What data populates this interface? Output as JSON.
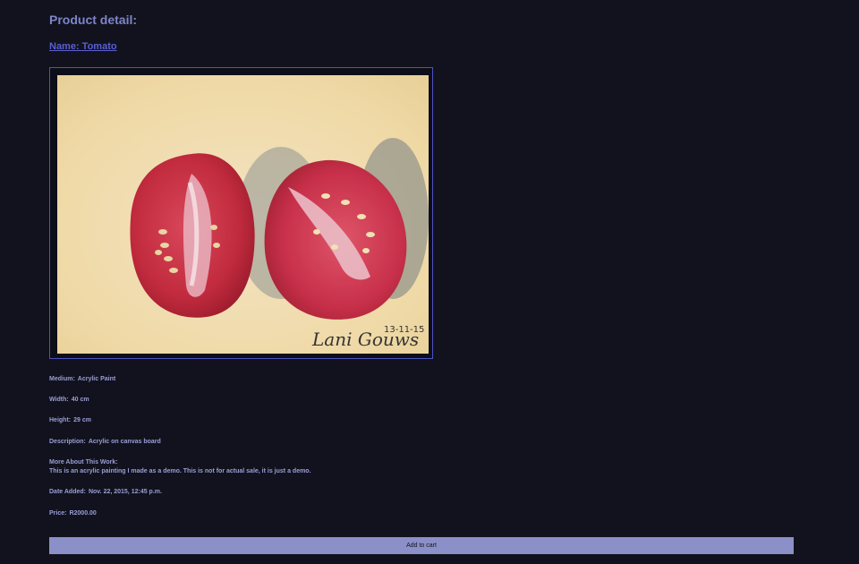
{
  "page": {
    "title": "Product detail:",
    "name_link": "Name: Tomato"
  },
  "image": {
    "alt": "Acrylic painting of two tomato halves",
    "signature": "Lani Gouws",
    "date": "13-11-15"
  },
  "details": {
    "medium": {
      "label": "Medium:",
      "value": "Acrylic Paint"
    },
    "width": {
      "label": "Width:",
      "value": "40 cm"
    },
    "height": {
      "label": "Height:",
      "value": "29 cm"
    },
    "description": {
      "label": "Description:",
      "value": "Acrylic on canvas board"
    },
    "more_about": {
      "label": "More About This Work:",
      "value": "This is an acrylic painting I made as a demo. This is not for actual sale, it is just a demo."
    },
    "date_added": {
      "label": "Date Added:",
      "value": "Nov. 22, 2015, 12:45 p.m."
    },
    "price": {
      "label": "Price:",
      "value": "R2000.00"
    }
  },
  "actions": {
    "add_to_cart": "Add to cart"
  },
  "colors": {
    "background": "#11121d",
    "accent": "#4d52c0",
    "button": "#8c90c8"
  }
}
